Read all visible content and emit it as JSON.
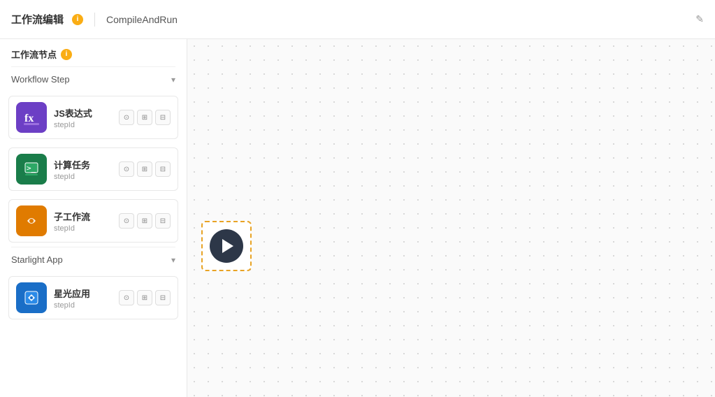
{
  "header": {
    "title": "工作流编辑",
    "info_tooltip": "i",
    "workflow_name": "CompileAndRun",
    "edit_icon": "✎"
  },
  "sidebar": {
    "section_title": "工作流节点",
    "info_tooltip": "i",
    "categories": [
      {
        "id": "workflow-step",
        "label": "Workflow Step",
        "expanded": true,
        "nodes": [
          {
            "id": "js-expr",
            "name": "JS表达式",
            "stepId": "stepId",
            "icon_type": "js"
          },
          {
            "id": "calc-task",
            "name": "计算任务",
            "stepId": "stepId",
            "icon_type": "calc"
          },
          {
            "id": "sub-workflow",
            "name": "子工作流",
            "stepId": "stepId",
            "icon_type": "sub"
          }
        ]
      },
      {
        "id": "starlight-app",
        "label": "Starlight App",
        "expanded": true,
        "nodes": [
          {
            "id": "starlight-app",
            "name": "星光应用",
            "stepId": "stepId",
            "icon_type": "starlight"
          }
        ]
      }
    ],
    "action_buttons": [
      "⊙",
      "⊞",
      "⊟"
    ]
  },
  "canvas": {
    "play_node": {
      "visible": true
    }
  }
}
